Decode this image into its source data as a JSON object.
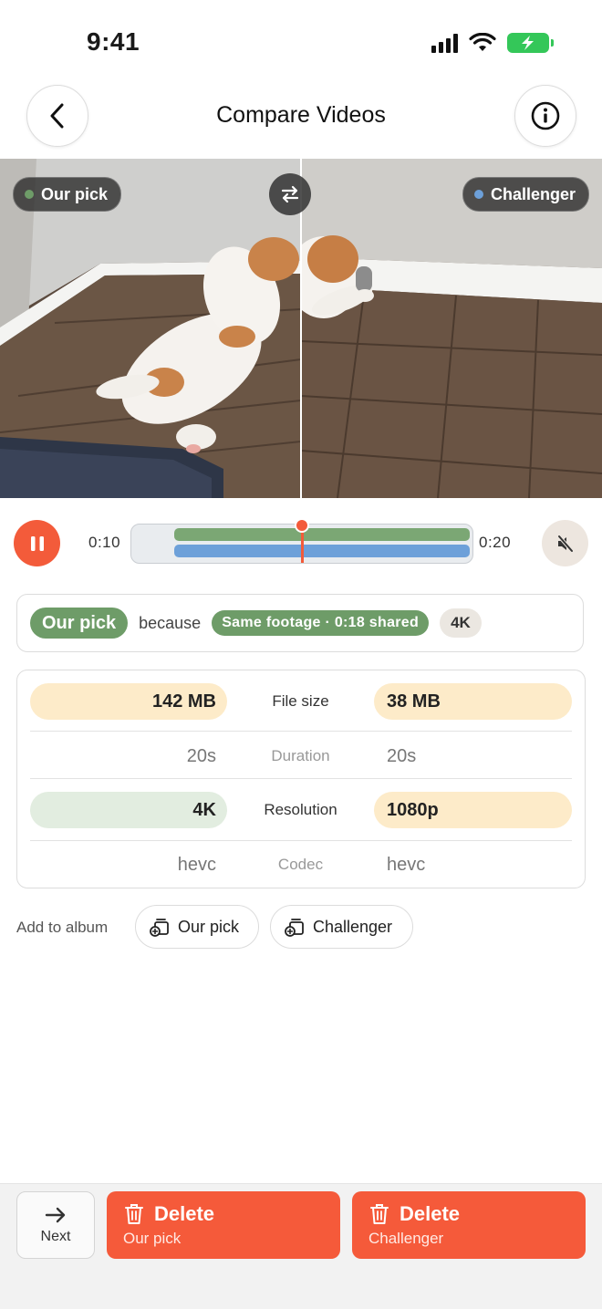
{
  "status_bar": {
    "time": "9:41"
  },
  "nav": {
    "title": "Compare Videos",
    "back_icon": "chevron-left-icon",
    "info_icon": "info-icon"
  },
  "video": {
    "left_label": "Our pick",
    "right_label": "Challenger",
    "left_dot_color": "#6e9c68",
    "right_dot_color": "#6da0d9",
    "swap_icon": "swap-arrows-icon"
  },
  "playback": {
    "current_time": "0:10",
    "end_time": "0:20",
    "playhead_fraction": 0.5,
    "pause_icon": "pause-icon",
    "mute_icon": "speaker-muted-icon"
  },
  "reason": {
    "pick_label": "Our pick",
    "because_label": "because",
    "footage_label": "Same footage · 0:18 shared",
    "quality_label": "4K"
  },
  "stats": [
    {
      "label": "File size",
      "left": "142 MB",
      "right": "38 MB"
    },
    {
      "label": "Duration",
      "left": "20s",
      "right": "20s"
    },
    {
      "label": "Resolution",
      "left": "4K",
      "right": "1080p"
    },
    {
      "label": "Codec",
      "left": "hevc",
      "right": "hevc"
    }
  ],
  "album": {
    "label": "Add to album",
    "buttons": [
      "Our pick",
      "Challenger"
    ]
  },
  "bottom": {
    "next_label": "Next",
    "delete_label": "Delete",
    "delete_left_sub": "Our pick",
    "delete_right_sub": "Challenger"
  },
  "colors": {
    "accent": "#f55a3a",
    "green": "#6e9c68",
    "blue": "#6da0d9"
  }
}
